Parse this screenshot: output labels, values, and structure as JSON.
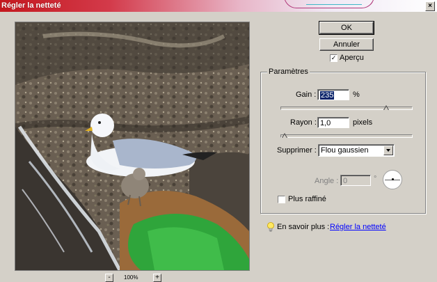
{
  "window": {
    "title": "Régler la netteté",
    "close_label": "×"
  },
  "preview": {
    "zoom_label": "100%",
    "zoom_minus": "-",
    "zoom_plus": "+"
  },
  "buttons": {
    "ok": "OK",
    "cancel": "Annuler"
  },
  "preview_checkbox": {
    "label": "Aperçu",
    "checked": true,
    "mark": "✓"
  },
  "parameters": {
    "group_title": "Paramètres",
    "gain": {
      "label": "Gain :",
      "value": "235",
      "unit": "%",
      "slider_fraction": 0.82
    },
    "radius": {
      "label": "Rayon :",
      "value": "1,0",
      "unit": "pixels",
      "slider_fraction": 0.01
    },
    "remove": {
      "label": "Supprimer :",
      "selected": "Flou gaussien"
    },
    "angle": {
      "label": "Angle :",
      "value": "0",
      "unit": "°"
    },
    "more_accurate": {
      "label": "Plus raffiné",
      "checked": false
    }
  },
  "help": {
    "prefix": "En savoir plus :",
    "link": "Régler la netteté"
  }
}
